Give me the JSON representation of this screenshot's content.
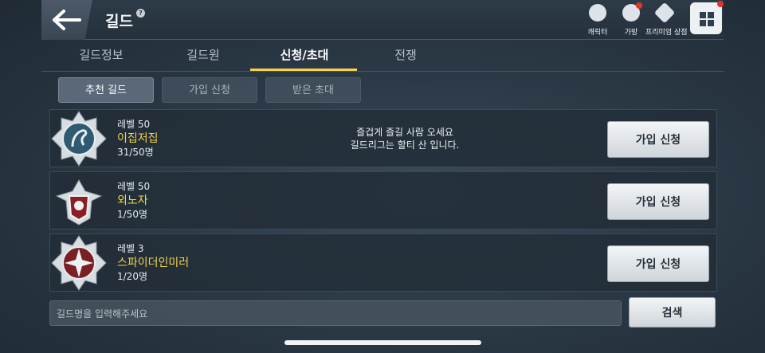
{
  "header": {
    "title": "길드",
    "help": "?",
    "icons": [
      {
        "name": "character",
        "label": "캐릭터"
      },
      {
        "name": "bag",
        "label": "가방"
      },
      {
        "name": "premium-shop",
        "label": "프리미엄 상점"
      }
    ]
  },
  "tabs": [
    "길드정보",
    "길드원",
    "신청/초대",
    "전쟁"
  ],
  "active_tab": "신청/초대",
  "subtabs": [
    "추천 길드",
    "가입 신청",
    "받은 초대"
  ],
  "active_subtab": "추천 길드",
  "guilds": [
    {
      "level": "레벨 50",
      "name": "이집저집",
      "members": "31/50명",
      "description": "즐겁게 즐길 사람 오세요\n길드리그는 할티 산 입니다.",
      "join_label": "가입 신청",
      "emblem": "dragon-emblem"
    },
    {
      "level": "레벨 50",
      "name": "외노자",
      "members": "1/50명",
      "description": "",
      "join_label": "가입 신청",
      "emblem": "eagle-shield-emblem"
    },
    {
      "level": "레벨 3",
      "name": "스파이더인미러",
      "members": "1/20명",
      "description": "",
      "join_label": "가입 신청",
      "emblem": "star-emblem"
    }
  ],
  "search": {
    "placeholder": "길드명을 입력해주세요",
    "button_label": "검색"
  },
  "colors": {
    "accent": "#f2d44c",
    "guild_name": "#f2d34a",
    "notification": "#e2342b"
  }
}
